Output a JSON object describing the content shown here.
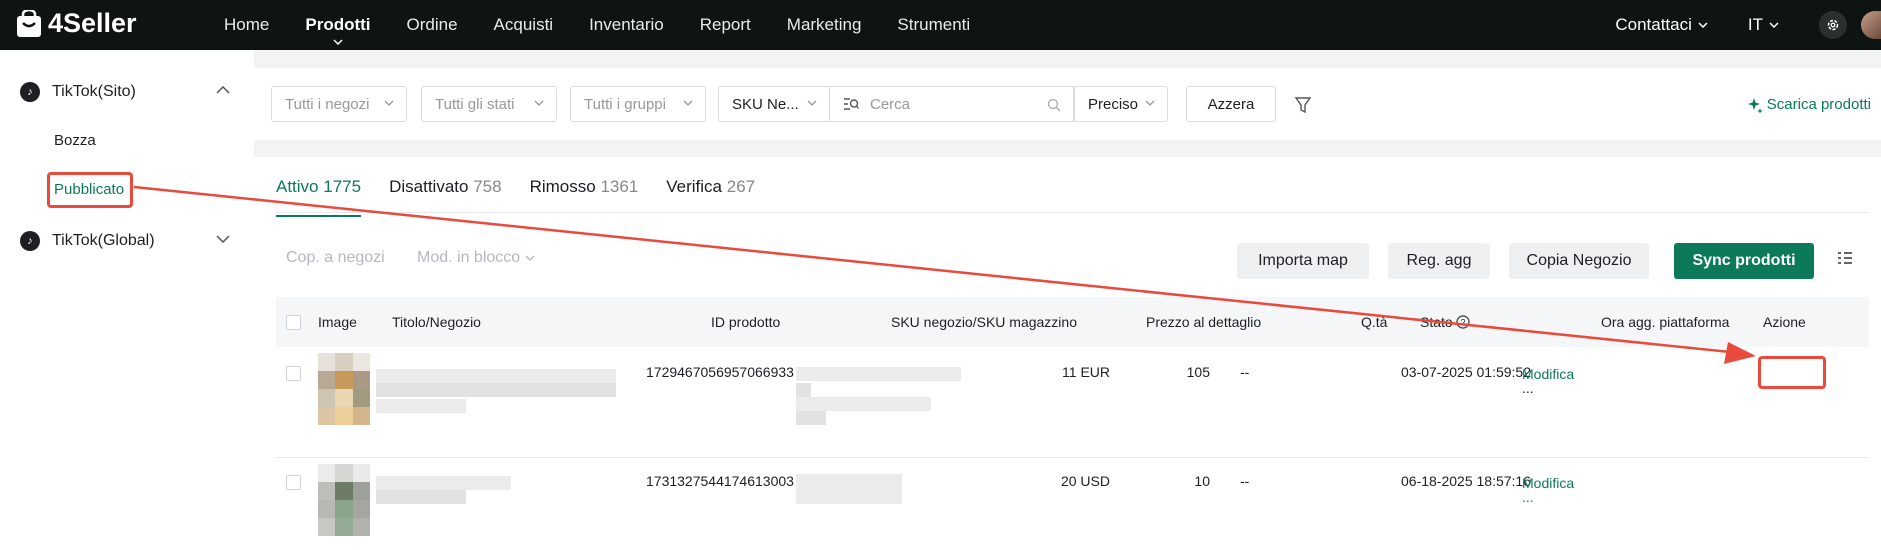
{
  "header": {
    "logo_text": "4Seller",
    "nav": [
      "Home",
      "Prodotti",
      "Ordine",
      "Acquisti",
      "Inventario",
      "Report",
      "Marketing",
      "Strumenti"
    ],
    "active_nav": "Prodotti",
    "contact_label": "Contattaci",
    "language_label": "IT"
  },
  "sidebar": {
    "groups": [
      {
        "label": "TikTok(Sito)",
        "icon": "tiktok-icon",
        "expanded": true,
        "items": [
          "Bozza",
          "Pubblicato"
        ]
      },
      {
        "label": "TikTok(Global)",
        "icon": "tiktok-icon",
        "expanded": false
      }
    ],
    "active_item": "Pubblicato"
  },
  "filters": {
    "shop_placeholder": "Tutti i negozi",
    "status_placeholder": "Tutti gli stati",
    "group_placeholder": "Tutti i gruppi",
    "search_field": "SKU Ne...",
    "search_placeholder": "Cerca",
    "match_mode": "Preciso",
    "reset_label": "Azzera",
    "download_label": "Scarica prodotti"
  },
  "tabs": [
    {
      "label": "Attivo",
      "count": "1775",
      "active": true
    },
    {
      "label": "Disattivato",
      "count": "758"
    },
    {
      "label": "Rimosso",
      "count": "1361"
    },
    {
      "label": "Verifica",
      "count": "267"
    }
  ],
  "toolbar": {
    "copy_to_shops": "Cop. a negozi",
    "bulk_edit": "Mod. in blocco",
    "import_map": "Importa map",
    "reg_agg": "Reg. agg",
    "copy_shop": "Copia Negozio",
    "sync": "Sync prodotti"
  },
  "table": {
    "columns": [
      "Image",
      "Titolo/Negozio",
      "ID prodotto",
      "SKU negozio/SKU magazzino",
      "Prezzo al dettaglio",
      "Q.tà",
      "Stato",
      "Ora agg. piattaforma",
      "Azione"
    ],
    "rows": [
      {
        "id": "1729467056957066933",
        "price": "11 EUR",
        "qty": "105",
        "status": "--",
        "updated": "03-07-2025 01:59:52",
        "action": "Modifica",
        "more": "..."
      },
      {
        "id": "1731327544174613003",
        "price": "20 USD",
        "qty": "10",
        "status": "--",
        "updated": "06-18-2025 18:57:16",
        "action": "Modifica",
        "more": "..."
      }
    ]
  },
  "colors": {
    "brand_green": "#0c7a5a",
    "annotation_red": "#e84a3c",
    "topbar": "#0d1411"
  }
}
